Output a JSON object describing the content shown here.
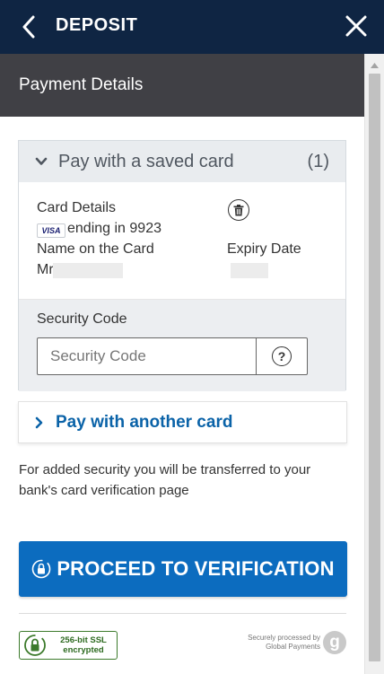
{
  "header": {
    "title": "DEPOSIT",
    "back_icon": "chevron-left-icon",
    "close_icon": "close-icon"
  },
  "section": {
    "title": "Payment Details"
  },
  "saved_card": {
    "label": "Pay with a saved card",
    "count": "(1)",
    "card_details_label": "Card Details",
    "card_brand": "VISA",
    "ending": "ending in 9923",
    "name_label": "Name on the Card",
    "name_value": "Mr",
    "expiry_label": "Expiry Date",
    "delete_icon": "trash-icon"
  },
  "security": {
    "label": "Security Code",
    "placeholder": "Security Code",
    "value": "",
    "help_symbol": "?"
  },
  "another_card": {
    "label": "Pay with another card"
  },
  "info_text": "For added security you will be transferred to your bank's card verification page",
  "proceed_button": {
    "label": "PROCEED TO VERIFICATION"
  },
  "footer": {
    "ssl_line1": "256-bit SSL",
    "ssl_line2": "encrypted",
    "gp_line1": "Securely processed by",
    "gp_line2": "Global Payments",
    "gp_logo": "g"
  },
  "colors": {
    "topbar": "#0f2543",
    "section_header": "#404045",
    "accent_blue": "#0c6cbf",
    "link_blue": "#0b63a8",
    "ssl_green": "#3c7a2b"
  }
}
